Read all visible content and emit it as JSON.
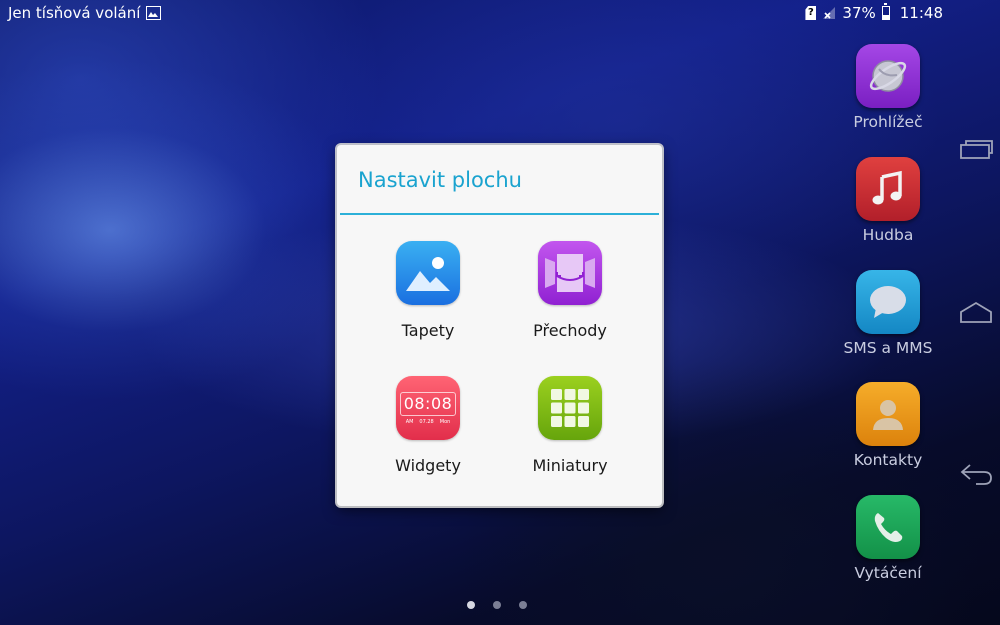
{
  "status_bar": {
    "carrier_text": "Jen tísňová volání",
    "sim_glyph": "?",
    "battery_percent": "37%",
    "battery_level": 0.37,
    "time": "11:48",
    "icons": [
      "image-notification-icon",
      "sim-card-icon",
      "signal-off-icon",
      "battery-icon"
    ]
  },
  "dock": {
    "items": [
      {
        "label": "Prohlížeč",
        "icon": "browser-globe-icon",
        "color": "#8a2bd1"
      },
      {
        "label": "Hudba",
        "icon": "music-note-icon",
        "color": "#c62a33"
      },
      {
        "label": "SMS a MMS",
        "icon": "chat-bubble-icon",
        "color": "#1fa1d8"
      },
      {
        "label": "Kontakty",
        "icon": "contact-person-icon",
        "color": "#f29a16"
      },
      {
        "label": "Vytáčení",
        "icon": "phone-handset-icon",
        "color": "#1aa55a"
      }
    ]
  },
  "nav_bar": {
    "buttons": [
      "recent-apps-icon",
      "home-icon",
      "back-icon"
    ]
  },
  "dialog": {
    "title": "Nastavit plochu",
    "accent_color": "#1aa3cf",
    "options": [
      {
        "label": "Tapety",
        "icon": "wallpaper-image-icon"
      },
      {
        "label": "Přechody",
        "icon": "transition-effect-icon"
      },
      {
        "label": "Widgety",
        "icon": "clock-widget-icon",
        "clock_text": "08:08",
        "clock_sub": [
          "AM",
          "07.28",
          "Mon"
        ]
      },
      {
        "label": "Miniatury",
        "icon": "grid-thumbnails-icon"
      }
    ]
  },
  "page_indicator": {
    "count": 3,
    "active_index": 0
  }
}
